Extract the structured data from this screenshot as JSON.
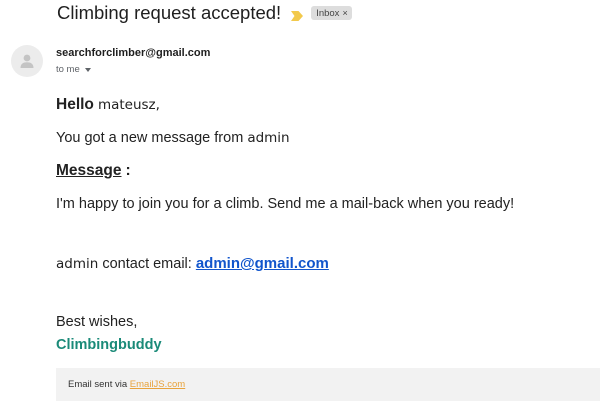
{
  "email": {
    "subject": "Climbing request accepted!",
    "label_chip": "Inbox",
    "chip_close": "×",
    "sender": "searchforclimber@gmail.com",
    "recipient": "to me"
  },
  "body": {
    "hello": "Hello",
    "name": "mateusz,",
    "new_message_prefix": "You got a new message from",
    "new_message_from": "admin",
    "message_heading": "Message",
    "message_colon": ":",
    "message_text": "I'm happy to join you for a climb. Send me a mail-back when you ready!",
    "contact_sender": "admin",
    "contact_label": "contact email:",
    "contact_email": "admin@gmail.com",
    "closing": "Best wishes,",
    "signature": "Climbingbuddy"
  },
  "footer": {
    "prefix": "Email sent via",
    "link": "EmailJS.com"
  },
  "colors": {
    "importance_marker": "#f2c94c",
    "link": "#1155cc",
    "signature": "#1a8a78",
    "footer_link": "#e8a33c"
  },
  "icons": {
    "importance": "importance-marker-icon",
    "avatar": "person-icon",
    "recipient_details": "caret-down-icon"
  }
}
